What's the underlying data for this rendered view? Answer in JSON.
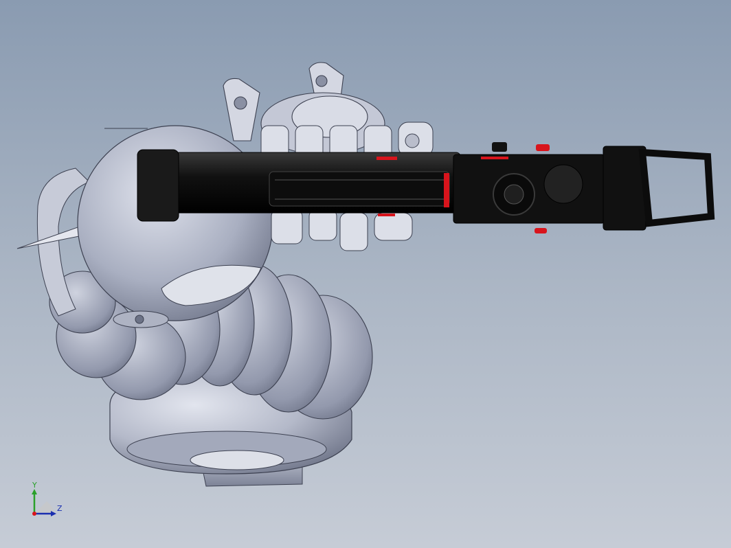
{
  "viewport": {
    "background_top": "#8a9bb1",
    "background_bottom": "#c6ccd6",
    "model": {
      "body_color": "#c9cdda",
      "body_shadow": "#7d8294",
      "arm_color": "#141414",
      "accent_color": "#d8141c"
    }
  },
  "triad": {
    "y_label": "Y",
    "z_label": "Z",
    "y_color": "#2aa02a",
    "z_color": "#1a2fb0",
    "x_color": "#d8141c"
  }
}
